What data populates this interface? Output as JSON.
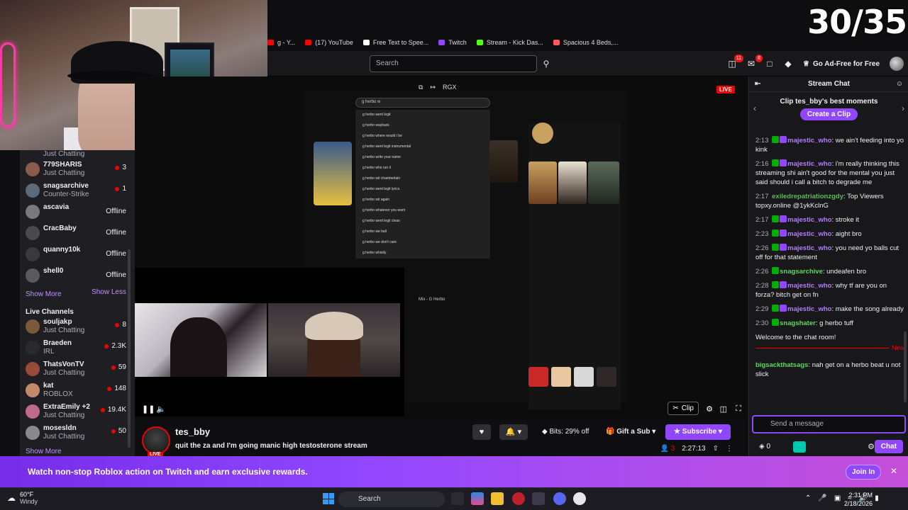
{
  "counter": "30/35",
  "bookmarks": [
    {
      "label": "g - Y...",
      "color": "#ff0000"
    },
    {
      "label": "(17) YouTube",
      "color": "#ff0000"
    },
    {
      "label": "Free Text to Spee...",
      "color": "#ffffff"
    },
    {
      "label": "Twitch",
      "color": "#9147ff"
    },
    {
      "label": "Stream - Kick Das...",
      "color": "#53fc18"
    },
    {
      "label": "Spacious 4 Beds,...",
      "color": "#ff5a5f"
    }
  ],
  "topnav": {
    "search_placeholder": "Search",
    "badge_inbox": "11",
    "badge_notifications": "8",
    "adfree_label": "Go Ad-Free for Free"
  },
  "sidebar": {
    "followed": [
      {
        "name": "",
        "game": "Just Chatting",
        "count": "",
        "offline": false,
        "color": "#6a4a3a"
      },
      {
        "name": "779SHARIS",
        "game": "Just Chatting",
        "count": "3",
        "offline": false,
        "color": "#8a5a4a"
      },
      {
        "name": "snagsarchive",
        "game": "Counter-Strike",
        "count": "1",
        "offline": false,
        "color": "#5a6a7a"
      },
      {
        "name": "ascavia",
        "game": "",
        "count": "",
        "offline": true,
        "color": "#7a7a7a"
      },
      {
        "name": "CracBaby",
        "game": "",
        "count": "",
        "offline": true,
        "color": "#4a4a4a"
      },
      {
        "name": "quanny10k",
        "game": "",
        "count": "",
        "offline": true,
        "color": "#3a3a3a"
      },
      {
        "name": "shell0",
        "game": "",
        "count": "",
        "offline": true,
        "color": "#5a5a5a"
      }
    ],
    "offline_label": "Offline",
    "show_more": "Show More",
    "show_less": "Show Less",
    "live_header": "Live Channels",
    "live": [
      {
        "name": "souljakp",
        "game": "Just Chatting",
        "count": "8",
        "color": "#7a5a3a"
      },
      {
        "name": "Braeden",
        "game": "IRL",
        "count": "2.3K",
        "color": "#2a2a2a"
      },
      {
        "name": "ThatsVonTV",
        "game": "Just Chatting",
        "count": "59",
        "color": "#9a4a3a"
      },
      {
        "name": "kat",
        "game": "ROBLOX",
        "count": "148",
        "color": "#c08a6a"
      },
      {
        "name": "ExtraEmily +2",
        "game": "Just Chatting",
        "count": "19.4K",
        "color": "#c06a8a"
      },
      {
        "name": "mosesldn",
        "game": "Just Chatting",
        "count": "50",
        "color": "#8a8a8a"
      }
    ],
    "show_more_live": "Show More"
  },
  "video": {
    "live_label": "LIVE",
    "rgx_label": "RGX",
    "clip_label": "Clip",
    "yt_query": "g herbo w",
    "yt_suggestions": [
      "g herbo went legit",
      "g herbo wayback",
      "g herbo where would i be",
      "g herbo went legit instrumental",
      "g herbo write your name",
      "g herbo who run it",
      "g herbo wit chamberlain",
      "g herbo went legit lyrics",
      "g herbo wit again",
      "g herbo whatever you want",
      "g herbo went legit clean",
      "g herbo we ball",
      "g herbo we don't care",
      "g herbo whistly"
    ],
    "yt_mix": "Mix - G Herbo"
  },
  "channel": {
    "name": "tes_bby",
    "title": "quit the za and I'm going manic high testosterone stream",
    "live": "LIVE",
    "bits": "Bits: 29% off",
    "gift": "Gift a Sub",
    "subscribe": "Subscribe",
    "viewers": "3",
    "uptime": "2:27:13"
  },
  "chat": {
    "title": "Stream Chat",
    "clip_promo": "Clip tes_bby's best moments",
    "create_clip": "Create a Clip",
    "messages": [
      {
        "time": "2:13",
        "badges": [
          "green",
          "purple"
        ],
        "user": "majestic_who",
        "color": "#b57bff",
        "text": "we ain't feeding into yo kink"
      },
      {
        "time": "2:16",
        "badges": [
          "green",
          "purple"
        ],
        "user": "majestic_who",
        "color": "#b57bff",
        "text": "i'm really thinking this streaming shi ain't good for the mental you just said should i call a bitch to degrade me"
      },
      {
        "time": "2:17",
        "badges": [],
        "user": "exiledrepatriationzgdy",
        "color": "#5cba5c",
        "text": "Top Viewers topxy.online @1ykKclnG"
      },
      {
        "time": "2:17",
        "badges": [
          "green",
          "purple"
        ],
        "user": "majestic_who",
        "color": "#b57bff",
        "text": "stroke it"
      },
      {
        "time": "2:23",
        "badges": [
          "green",
          "purple"
        ],
        "user": "majestic_who",
        "color": "#b57bff",
        "text": "aight bro"
      },
      {
        "time": "2:26",
        "badges": [
          "green",
          "purple"
        ],
        "user": "majestic_who",
        "color": "#b57bff",
        "text": "you need yo balls cut off for that statement"
      },
      {
        "time": "2:26",
        "badges": [
          "green"
        ],
        "user": "snagsarchive",
        "color": "#5cd85c",
        "text": "undeafen bro"
      },
      {
        "time": "2:28",
        "badges": [
          "green",
          "purple"
        ],
        "user": "majestic_who",
        "color": "#b57bff",
        "text": "why tf are you on forza? bitch get on fn"
      },
      {
        "time": "2:29",
        "badges": [
          "green",
          "purple"
        ],
        "user": "majestic_who",
        "color": "#b57bff",
        "text": "make the song already"
      },
      {
        "time": "2:30",
        "badges": [
          "green"
        ],
        "user": "snagshater",
        "color": "#5cd85c",
        "text": "g herbo tuff"
      }
    ],
    "welcome": "Welcome to the chat room!",
    "new_label": "New",
    "new_message": {
      "user": "bigsackthatsags",
      "color": "#5cd85c",
      "text": "nah get on a herbo beat u not slick"
    },
    "input_placeholder": "Send a message",
    "points": "0",
    "chat_button": "Chat"
  },
  "banner": {
    "text": "Watch non-stop Roblox action on Twitch and earn exclusive rewards.",
    "join": "Join In"
  },
  "taskbar": {
    "temp": "60°F",
    "condition": "Windy",
    "search": "Search",
    "time": "2:31 PM",
    "date": "2/18/2026"
  }
}
